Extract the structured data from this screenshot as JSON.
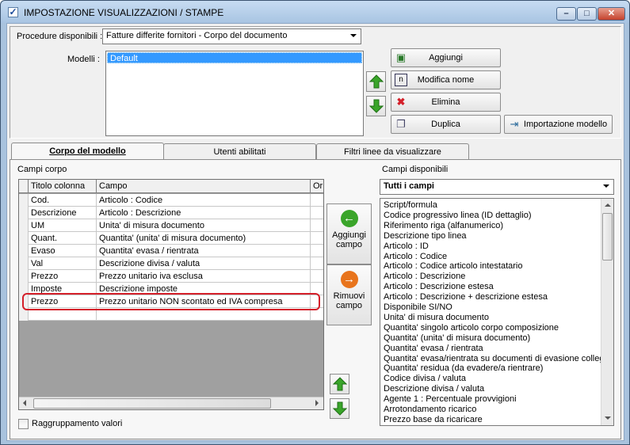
{
  "window": {
    "title": "IMPOSTAZIONE VISUALIZZAZIONI / STAMPE"
  },
  "top": {
    "procedure_label": "Procedure disponibili :",
    "procedure_value": "Fatture differite fornitori - Corpo del documento",
    "modelli_label": "Modelli :",
    "modelli_items": [
      "Default"
    ],
    "buttons": {
      "aggiungi": "Aggiungi",
      "modifica": "Modifica nome",
      "elimina": "Elimina",
      "duplica": "Duplica",
      "importazione": "Importazione modello"
    }
  },
  "tabs": [
    "Corpo del modello",
    "Utenti abilitati",
    "Filtri linee da visualizzare"
  ],
  "corpo": {
    "section_label": "Campi corpo",
    "columns": [
      "Titolo colonna",
      "Campo",
      "Or"
    ],
    "rows": [
      {
        "titolo": "Cod.",
        "campo": "Articolo : Codice"
      },
      {
        "titolo": "Descrizione",
        "campo": "Articolo : Descrizione"
      },
      {
        "titolo": "UM",
        "campo": "Unita' di misura documento"
      },
      {
        "titolo": "Quant.",
        "campo": "Quantita' (unita' di misura documento)"
      },
      {
        "titolo": "Evaso",
        "campo": "Quantita' evasa / rientrata"
      },
      {
        "titolo": "Val",
        "campo": "Descrizione divisa / valuta"
      },
      {
        "titolo": "Prezzo",
        "campo": "Prezzo unitario iva esclusa"
      },
      {
        "titolo": "Imposte",
        "campo": "Descrizione imposte"
      },
      {
        "titolo": "Prezzo",
        "campo": "Prezzo unitario NON scontato ed IVA compresa"
      },
      {
        "titolo": "",
        "campo": ""
      }
    ],
    "aggiungi_campo": "Aggiungi campo",
    "rimuovi_campo": "Rimuovi campo",
    "raggruppamento_label": "Raggruppamento valori"
  },
  "disponibili": {
    "section_label": "Campi disponibili",
    "filter_value": "Tutti i campi",
    "items": [
      "Script/formula",
      "Codice progressivo linea (ID dettaglio)",
      "Riferimento riga (alfanumerico)",
      "Descrizione tipo linea",
      "Articolo : ID",
      "Articolo : Codice",
      "Articolo : Codice articolo intestatario",
      "Articolo : Descrizione",
      "Articolo : Descrizione estesa",
      "Articolo : Descrizione + descrizione estesa",
      "Disponibile SI/NO",
      "Unita' di misura documento",
      "Quantita' singolo articolo corpo composizione",
      "Quantita' (unita' di misura documento)",
      "Quantita' evasa / rientrata",
      "Quantita' evasa/rientrata su documenti di evasione colleg",
      "Quantita' residua (da evadere/a rientrare)",
      "Codice divisa / valuta",
      "Descrizione divisa / valuta",
      "Agente 1 : Percentuale provvigioni",
      "Arrotondamento ricarico",
      "Prezzo base da ricaricare"
    ]
  },
  "colors": {
    "highlight": "#d4202a",
    "selection": "#3399ff",
    "green_arrow": "#3aa52a",
    "orange": "#e8741c"
  }
}
